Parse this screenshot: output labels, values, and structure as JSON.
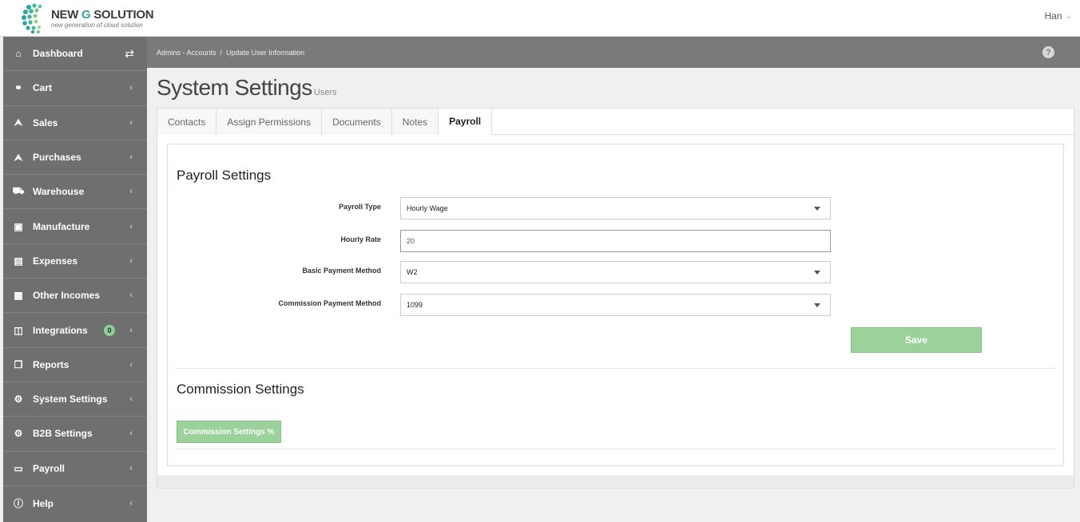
{
  "brand": {
    "name_part1": "NEW ",
    "name_part2": "G",
    "name_part3": " SOLUTION",
    "tagline": "new generation of cloud solution"
  },
  "user": {
    "name": "Han"
  },
  "sidebar": {
    "items": [
      {
        "label": "Dashboard",
        "icon": "home-icon"
      },
      {
        "label": "Cart",
        "icon": "cart-icon"
      },
      {
        "label": "Sales",
        "icon": "upload-icon"
      },
      {
        "label": "Purchases",
        "icon": "upload-icon"
      },
      {
        "label": "Warehouse",
        "icon": "truck-icon"
      },
      {
        "label": "Manufacture",
        "icon": "factory-icon"
      },
      {
        "label": "Expenses",
        "icon": "document-icon"
      },
      {
        "label": "Other Incomes",
        "icon": "money-icon"
      },
      {
        "label": "Integrations",
        "icon": "integrations-icon",
        "badge": "0"
      },
      {
        "label": "Reports",
        "icon": "copy-icon"
      },
      {
        "label": "System Settings",
        "icon": "gears-icon"
      },
      {
        "label": "B2B Settings",
        "icon": "gears-icon"
      },
      {
        "label": "Payroll",
        "icon": "wallet-icon"
      },
      {
        "label": "Help",
        "icon": "question-circle-icon"
      }
    ]
  },
  "breadcrumb": {
    "parent": "Admins - Accounts",
    "separator": "/",
    "current": "Update User Information"
  },
  "page": {
    "title": "System Settings",
    "subtitle": "Users"
  },
  "tabs": [
    "Contacts",
    "Assign Permissions",
    "Documents",
    "Notes",
    "Payroll"
  ],
  "active_tab": "Payroll",
  "payroll": {
    "title": "Payroll Settings",
    "payroll_type_label": "Payroll Type",
    "payroll_type_value": "Hourly Wage",
    "hourly_rate_label": "Hourly Rate",
    "hourly_rate_value": "20",
    "basic_method_label": "Basic Payment Method",
    "basic_method_value": "W2",
    "commission_method_label": "Commission Payment Method",
    "commission_method_value": "1099",
    "save_label": "Save"
  },
  "commission": {
    "title": "Commission Settings",
    "button_label": "Commission Settings %"
  },
  "colors": {
    "accent_green": "#9bd19b",
    "sidebar_bg": "#6f6f6f",
    "brand_teal": "#2aa5a0"
  }
}
